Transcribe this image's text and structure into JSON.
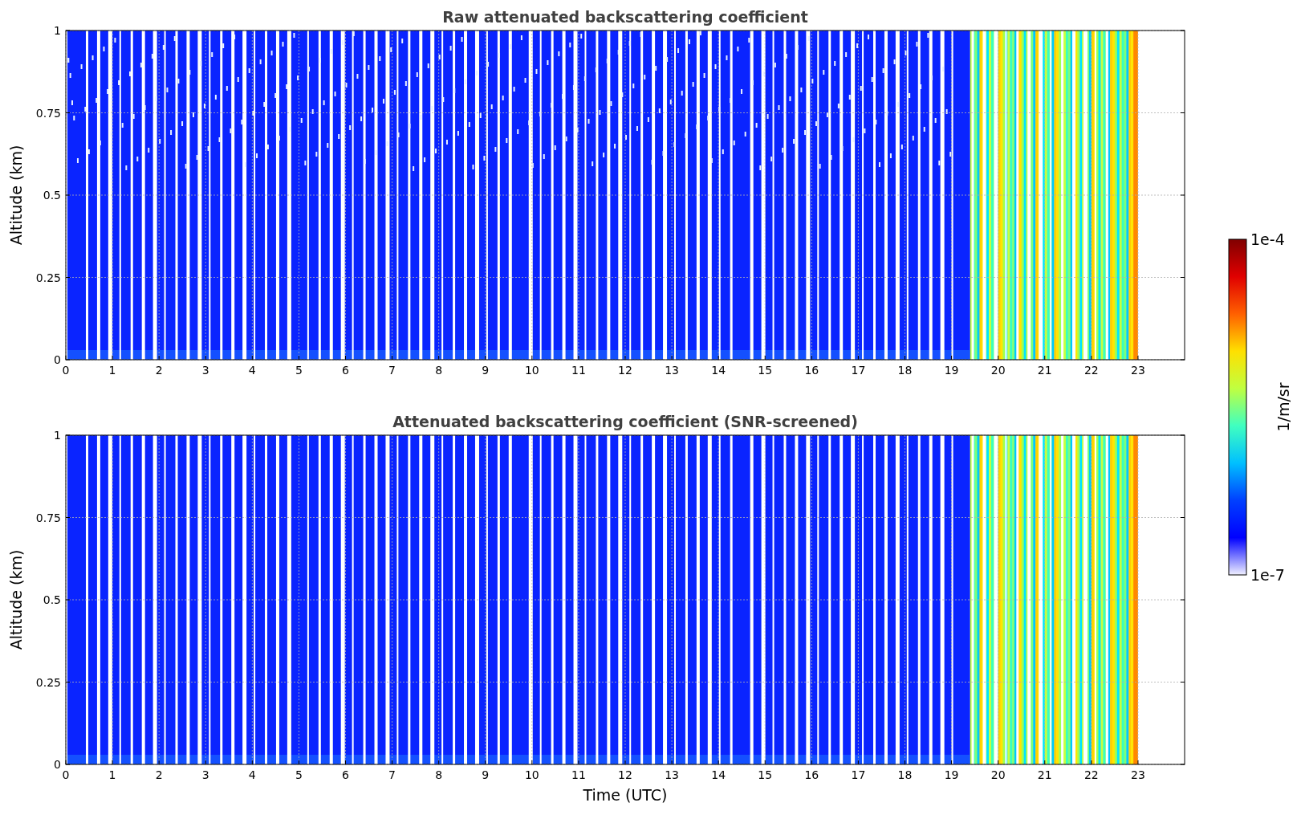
{
  "panels": [
    {
      "title": "Raw attenuated backscattering coefficient",
      "ylabel": "Altitude (km)",
      "yticks": [
        "1",
        "0.75",
        "0.5",
        "0.25",
        "0"
      ],
      "xticks": [
        "0",
        "1",
        "2",
        "3",
        "4",
        "5",
        "6",
        "7",
        "8",
        "9",
        "10",
        "11",
        "12",
        "13",
        "14",
        "15",
        "16",
        "17",
        "18",
        "19",
        "20",
        "21",
        "22",
        "23"
      ]
    },
    {
      "title": "Attenuated backscattering coefficient (SNR-screened)",
      "ylabel": "Altitude (km)",
      "yticks": [
        "1",
        "0.75",
        "0.5",
        "0.25",
        "0"
      ],
      "xticks": [
        "0",
        "1",
        "2",
        "3",
        "4",
        "5",
        "6",
        "7",
        "8",
        "9",
        "10",
        "11",
        "12",
        "13",
        "14",
        "15",
        "16",
        "17",
        "18",
        "19",
        "20",
        "21",
        "22",
        "23"
      ],
      "xlabel": "Time (UTC)"
    }
  ],
  "colorbar": {
    "max_label": "1e-4",
    "min_label": "1e-7",
    "label": "1/m/sr"
  }
}
